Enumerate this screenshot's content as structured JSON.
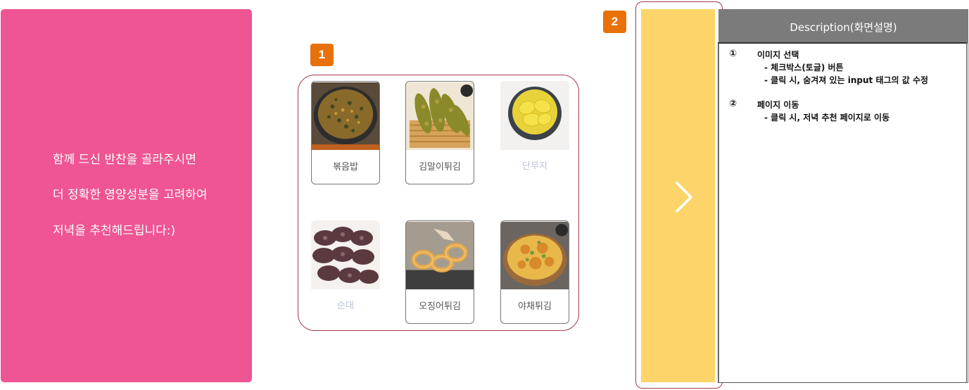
{
  "intro": {
    "line1": "함께 드신 반찬을 골라주시면",
    "line2": "더 정확한 영양성분을 고려하여",
    "line3": "저녁을 추천해드립니다:)"
  },
  "badges": {
    "one": "1",
    "two": "2"
  },
  "food_items": [
    {
      "label": "볶음밥",
      "selected": true
    },
    {
      "label": "김말이튀김",
      "selected": true
    },
    {
      "label": "단무지",
      "selected": false
    },
    {
      "label": "순대",
      "selected": false
    },
    {
      "label": "오징어튀김",
      "selected": true
    },
    {
      "label": "야채튀김",
      "selected": true
    }
  ],
  "nav": {
    "icon": "chevron-right-icon"
  },
  "description": {
    "header": "Description(화면설명)",
    "items": [
      {
        "num": "①",
        "title": "이미지 선택",
        "lines": [
          "- 체크박스(토글) 버튼",
          "- 클릭 시, 숨겨져 있는 input 태그의 값 수정"
        ]
      },
      {
        "num": "②",
        "title": "페이지 이동",
        "lines": [
          "- 클릭 시, 저녁 추천 페이지로 이동"
        ]
      }
    ]
  },
  "colors": {
    "pink": "#ee5592",
    "yellow": "#fcd46a",
    "badge": "#e8710a",
    "outline": "#a33a4a",
    "header": "#7b7b7b"
  }
}
